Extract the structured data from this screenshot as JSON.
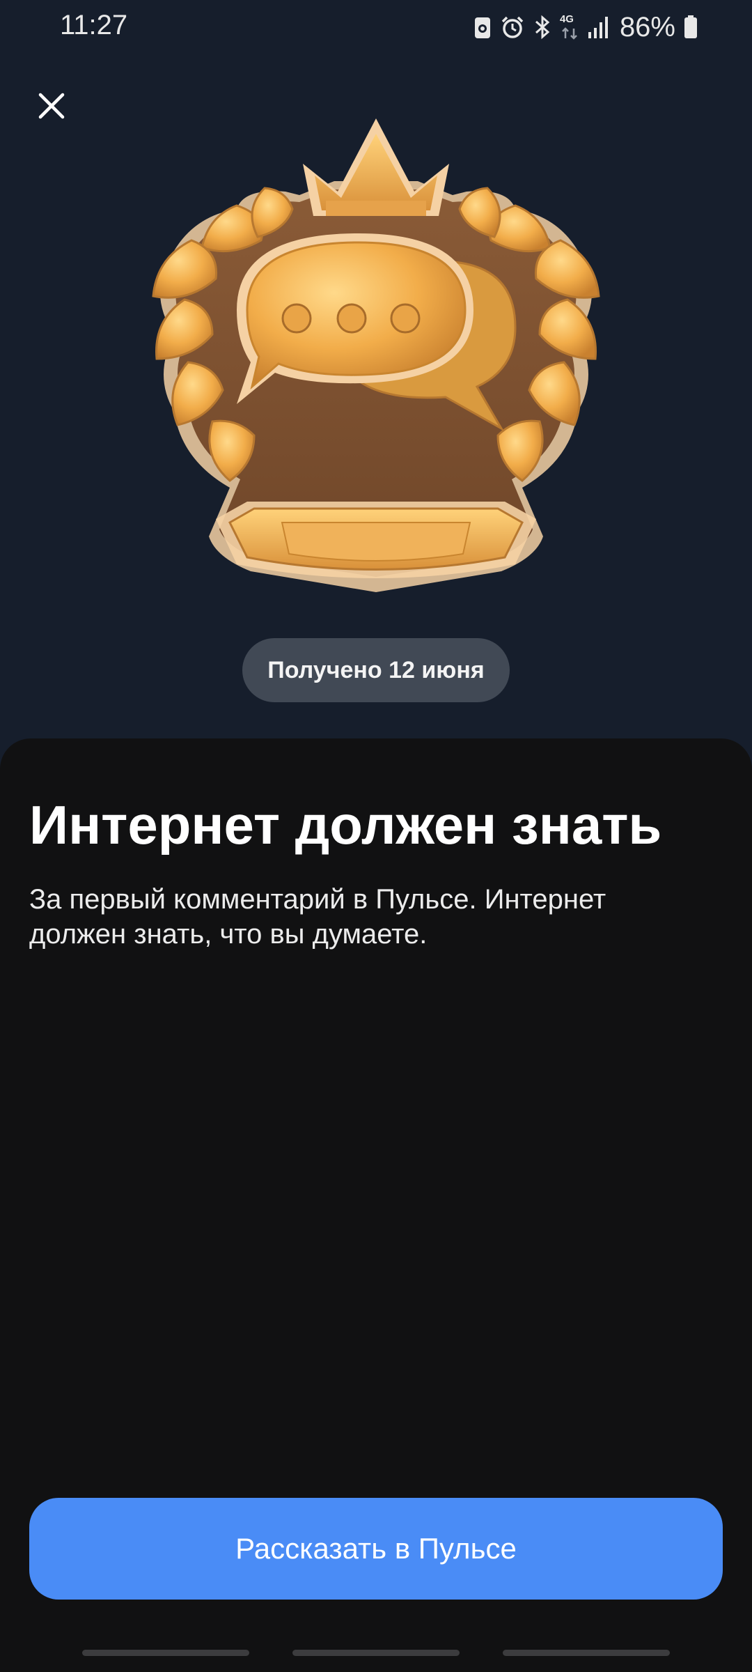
{
  "status_bar": {
    "time": "11:27",
    "network": "4G",
    "battery": "86%",
    "icons": [
      "photo-notification-icon",
      "alarm-icon",
      "bluetooth-icon",
      "network-4g-icon",
      "signal-icon",
      "battery-icon"
    ]
  },
  "close_icon": "close-icon",
  "badge": {
    "icon": "chat-bubble-crown-badge",
    "colors": {
      "gold": "#f2b14f",
      "bronze": "#a06a3e",
      "brown": "#7a5236"
    }
  },
  "earned_date": "Получено 12 июня",
  "achievement": {
    "title": "Интернет должен знать",
    "description_line1": "За первый комментарий в Пульсе. Интернет",
    "description_line2": "должен знать, что вы думаете."
  },
  "cta_label": "Рассказать в Пульсе",
  "colors": {
    "background": "#161e2c",
    "sheet": "#111112",
    "accent": "#4a8cf6",
    "pill": "#414955"
  }
}
